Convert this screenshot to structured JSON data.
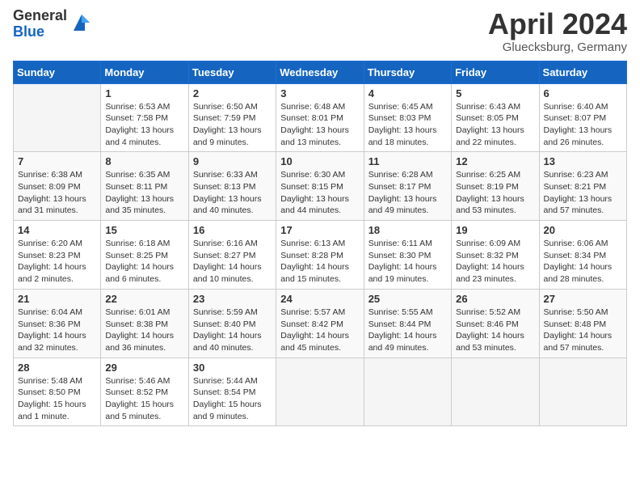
{
  "header": {
    "logo_general": "General",
    "logo_blue": "Blue",
    "title": "April 2024",
    "location": "Gluecksburg, Germany"
  },
  "days_of_week": [
    "Sunday",
    "Monday",
    "Tuesday",
    "Wednesday",
    "Thursday",
    "Friday",
    "Saturday"
  ],
  "weeks": [
    [
      {
        "day": "",
        "sunrise": "",
        "sunset": "",
        "daylight": ""
      },
      {
        "day": "1",
        "sunrise": "Sunrise: 6:53 AM",
        "sunset": "Sunset: 7:58 PM",
        "daylight": "Daylight: 13 hours and 4 minutes."
      },
      {
        "day": "2",
        "sunrise": "Sunrise: 6:50 AM",
        "sunset": "Sunset: 7:59 PM",
        "daylight": "Daylight: 13 hours and 9 minutes."
      },
      {
        "day": "3",
        "sunrise": "Sunrise: 6:48 AM",
        "sunset": "Sunset: 8:01 PM",
        "daylight": "Daylight: 13 hours and 13 minutes."
      },
      {
        "day": "4",
        "sunrise": "Sunrise: 6:45 AM",
        "sunset": "Sunset: 8:03 PM",
        "daylight": "Daylight: 13 hours and 18 minutes."
      },
      {
        "day": "5",
        "sunrise": "Sunrise: 6:43 AM",
        "sunset": "Sunset: 8:05 PM",
        "daylight": "Daylight: 13 hours and 22 minutes."
      },
      {
        "day": "6",
        "sunrise": "Sunrise: 6:40 AM",
        "sunset": "Sunset: 8:07 PM",
        "daylight": "Daylight: 13 hours and 26 minutes."
      }
    ],
    [
      {
        "day": "7",
        "sunrise": "Sunrise: 6:38 AM",
        "sunset": "Sunset: 8:09 PM",
        "daylight": "Daylight: 13 hours and 31 minutes."
      },
      {
        "day": "8",
        "sunrise": "Sunrise: 6:35 AM",
        "sunset": "Sunset: 8:11 PM",
        "daylight": "Daylight: 13 hours and 35 minutes."
      },
      {
        "day": "9",
        "sunrise": "Sunrise: 6:33 AM",
        "sunset": "Sunset: 8:13 PM",
        "daylight": "Daylight: 13 hours and 40 minutes."
      },
      {
        "day": "10",
        "sunrise": "Sunrise: 6:30 AM",
        "sunset": "Sunset: 8:15 PM",
        "daylight": "Daylight: 13 hours and 44 minutes."
      },
      {
        "day": "11",
        "sunrise": "Sunrise: 6:28 AM",
        "sunset": "Sunset: 8:17 PM",
        "daylight": "Daylight: 13 hours and 49 minutes."
      },
      {
        "day": "12",
        "sunrise": "Sunrise: 6:25 AM",
        "sunset": "Sunset: 8:19 PM",
        "daylight": "Daylight: 13 hours and 53 minutes."
      },
      {
        "day": "13",
        "sunrise": "Sunrise: 6:23 AM",
        "sunset": "Sunset: 8:21 PM",
        "daylight": "Daylight: 13 hours and 57 minutes."
      }
    ],
    [
      {
        "day": "14",
        "sunrise": "Sunrise: 6:20 AM",
        "sunset": "Sunset: 8:23 PM",
        "daylight": "Daylight: 14 hours and 2 minutes."
      },
      {
        "day": "15",
        "sunrise": "Sunrise: 6:18 AM",
        "sunset": "Sunset: 8:25 PM",
        "daylight": "Daylight: 14 hours and 6 minutes."
      },
      {
        "day": "16",
        "sunrise": "Sunrise: 6:16 AM",
        "sunset": "Sunset: 8:27 PM",
        "daylight": "Daylight: 14 hours and 10 minutes."
      },
      {
        "day": "17",
        "sunrise": "Sunrise: 6:13 AM",
        "sunset": "Sunset: 8:28 PM",
        "daylight": "Daylight: 14 hours and 15 minutes."
      },
      {
        "day": "18",
        "sunrise": "Sunrise: 6:11 AM",
        "sunset": "Sunset: 8:30 PM",
        "daylight": "Daylight: 14 hours and 19 minutes."
      },
      {
        "day": "19",
        "sunrise": "Sunrise: 6:09 AM",
        "sunset": "Sunset: 8:32 PM",
        "daylight": "Daylight: 14 hours and 23 minutes."
      },
      {
        "day": "20",
        "sunrise": "Sunrise: 6:06 AM",
        "sunset": "Sunset: 8:34 PM",
        "daylight": "Daylight: 14 hours and 28 minutes."
      }
    ],
    [
      {
        "day": "21",
        "sunrise": "Sunrise: 6:04 AM",
        "sunset": "Sunset: 8:36 PM",
        "daylight": "Daylight: 14 hours and 32 minutes."
      },
      {
        "day": "22",
        "sunrise": "Sunrise: 6:01 AM",
        "sunset": "Sunset: 8:38 PM",
        "daylight": "Daylight: 14 hours and 36 minutes."
      },
      {
        "day": "23",
        "sunrise": "Sunrise: 5:59 AM",
        "sunset": "Sunset: 8:40 PM",
        "daylight": "Daylight: 14 hours and 40 minutes."
      },
      {
        "day": "24",
        "sunrise": "Sunrise: 5:57 AM",
        "sunset": "Sunset: 8:42 PM",
        "daylight": "Daylight: 14 hours and 45 minutes."
      },
      {
        "day": "25",
        "sunrise": "Sunrise: 5:55 AM",
        "sunset": "Sunset: 8:44 PM",
        "daylight": "Daylight: 14 hours and 49 minutes."
      },
      {
        "day": "26",
        "sunrise": "Sunrise: 5:52 AM",
        "sunset": "Sunset: 8:46 PM",
        "daylight": "Daylight: 14 hours and 53 minutes."
      },
      {
        "day": "27",
        "sunrise": "Sunrise: 5:50 AM",
        "sunset": "Sunset: 8:48 PM",
        "daylight": "Daylight: 14 hours and 57 minutes."
      }
    ],
    [
      {
        "day": "28",
        "sunrise": "Sunrise: 5:48 AM",
        "sunset": "Sunset: 8:50 PM",
        "daylight": "Daylight: 15 hours and 1 minute."
      },
      {
        "day": "29",
        "sunrise": "Sunrise: 5:46 AM",
        "sunset": "Sunset: 8:52 PM",
        "daylight": "Daylight: 15 hours and 5 minutes."
      },
      {
        "day": "30",
        "sunrise": "Sunrise: 5:44 AM",
        "sunset": "Sunset: 8:54 PM",
        "daylight": "Daylight: 15 hours and 9 minutes."
      },
      {
        "day": "",
        "sunrise": "",
        "sunset": "",
        "daylight": ""
      },
      {
        "day": "",
        "sunrise": "",
        "sunset": "",
        "daylight": ""
      },
      {
        "day": "",
        "sunrise": "",
        "sunset": "",
        "daylight": ""
      },
      {
        "day": "",
        "sunrise": "",
        "sunset": "",
        "daylight": ""
      }
    ]
  ]
}
